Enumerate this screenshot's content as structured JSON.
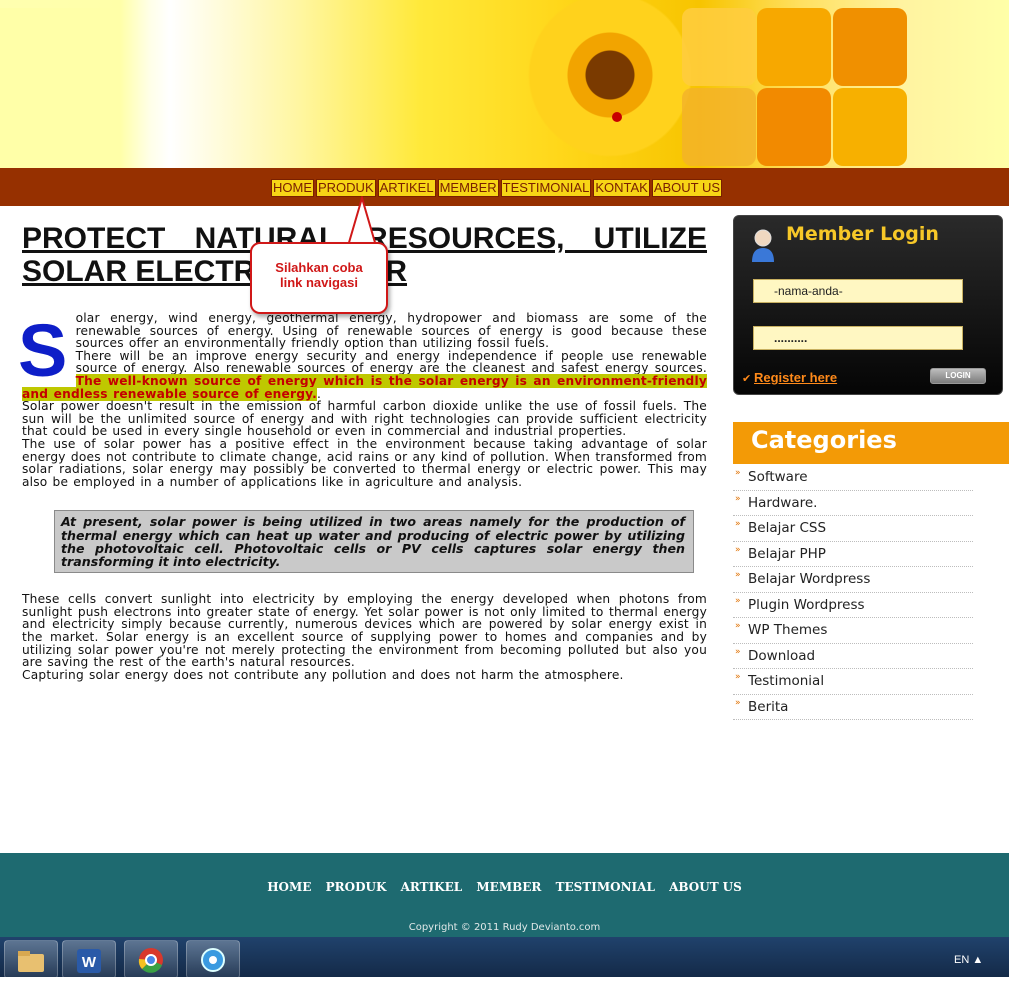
{
  "nav": {
    "items": [
      "HOME",
      "PRODUK",
      "ARTIKEL",
      "MEMBER",
      "TESTIMONIAL",
      "KONTAK",
      "ABOUT US"
    ]
  },
  "tooltip": {
    "line1": "Silahkan coba",
    "line2": "link navigasi"
  },
  "article": {
    "title": "PROTECT NATURAL RESOURCES, UTILIZE SOLAR ELECTRIC POWER",
    "dropcap": "S",
    "para1": "olar energy, wind energy, geothermal energy, hydropower and biomass are some of the renewable sources of energy. Using of renewable sources of energy is good because these sources offer an environmentally friendly option than utilizing fossil fuels.",
    "para1b": "There will be an improve energy security and energy independence if people use renewable source of energy. Also renewable sources of energy are the cleanest and safest energy sources.",
    "highlight": "The well-known source of energy which is the solar energy is an environment-friendly and endless renewable source of energy.",
    "para2": "Solar power doesn't result in the emission of harmful carbon dioxide unlike the use of fossil fuels. The sun will be the unlimited source of energy and with right technologies can provide sufficient electricity that could be used in every single household or even in commercial and industrial properties.",
    "para2b": "The use of solar power has a positive effect in the environment because taking advantage of solar energy does not contribute to climate change, acid rains or any kind of pollution. When transformed from solar radiations, solar energy may possibly be converted to thermal energy or electric power. This may also be employed in a number of applications like in agriculture and analysis.",
    "quote": "At present, solar power is being utilized in two areas namely for the production of thermal energy which can heat up water and producing of electric power by utilizing the photovoltaic cell. Photovoltaic cells or PV cells captures solar energy then transforming it into electricity.",
    "para3": "These cells convert sunlight into electricity by employing the energy developed when photons from sunlight push electrons into greater state of energy. Yet solar power is not only limited to thermal energy and electricity simply because currently, numerous devices which are powered by solar energy exist in the market. Solar energy is an excellent source of supplying power to homes and companies and by utilizing solar power you're not merely protecting the environment from becoming polluted but also you are saving the rest of the earth's natural resources.",
    "para3b": "Capturing solar energy does not contribute any pollution and does not harm the atmosphere."
  },
  "login": {
    "title": "Member Login",
    "username_value": "-nama-anda-",
    "password_value": "..........",
    "register_label": "Register here",
    "button_label": "LOGIN"
  },
  "categories": {
    "title": "Categories",
    "items": [
      "Software",
      "Hardware.",
      "Belajar CSS",
      "Belajar PHP",
      "Belajar Wordpress",
      "Plugin Wordpress",
      "WP Themes",
      "Download",
      "Testimonial",
      "Berita"
    ]
  },
  "footer": {
    "nav": [
      "HOME",
      "PRODUK",
      "ARTIKEL",
      "MEMBER",
      "TESTIMONIAL",
      "ABOUT",
      "US"
    ],
    "copyright": "Copyright © 2011 Rudy Devianto.com"
  },
  "taskbar": {
    "language": "EN"
  },
  "colors": {
    "nav_bar": "#963000",
    "nav_item": "#f7d516",
    "highlight_bg": "#bfc800",
    "highlight_text": "#c40000",
    "dropcap": "#0e1ec8",
    "category_header": "#f39a06",
    "footer": "#1e6a70",
    "login_title": "#f7c828"
  }
}
